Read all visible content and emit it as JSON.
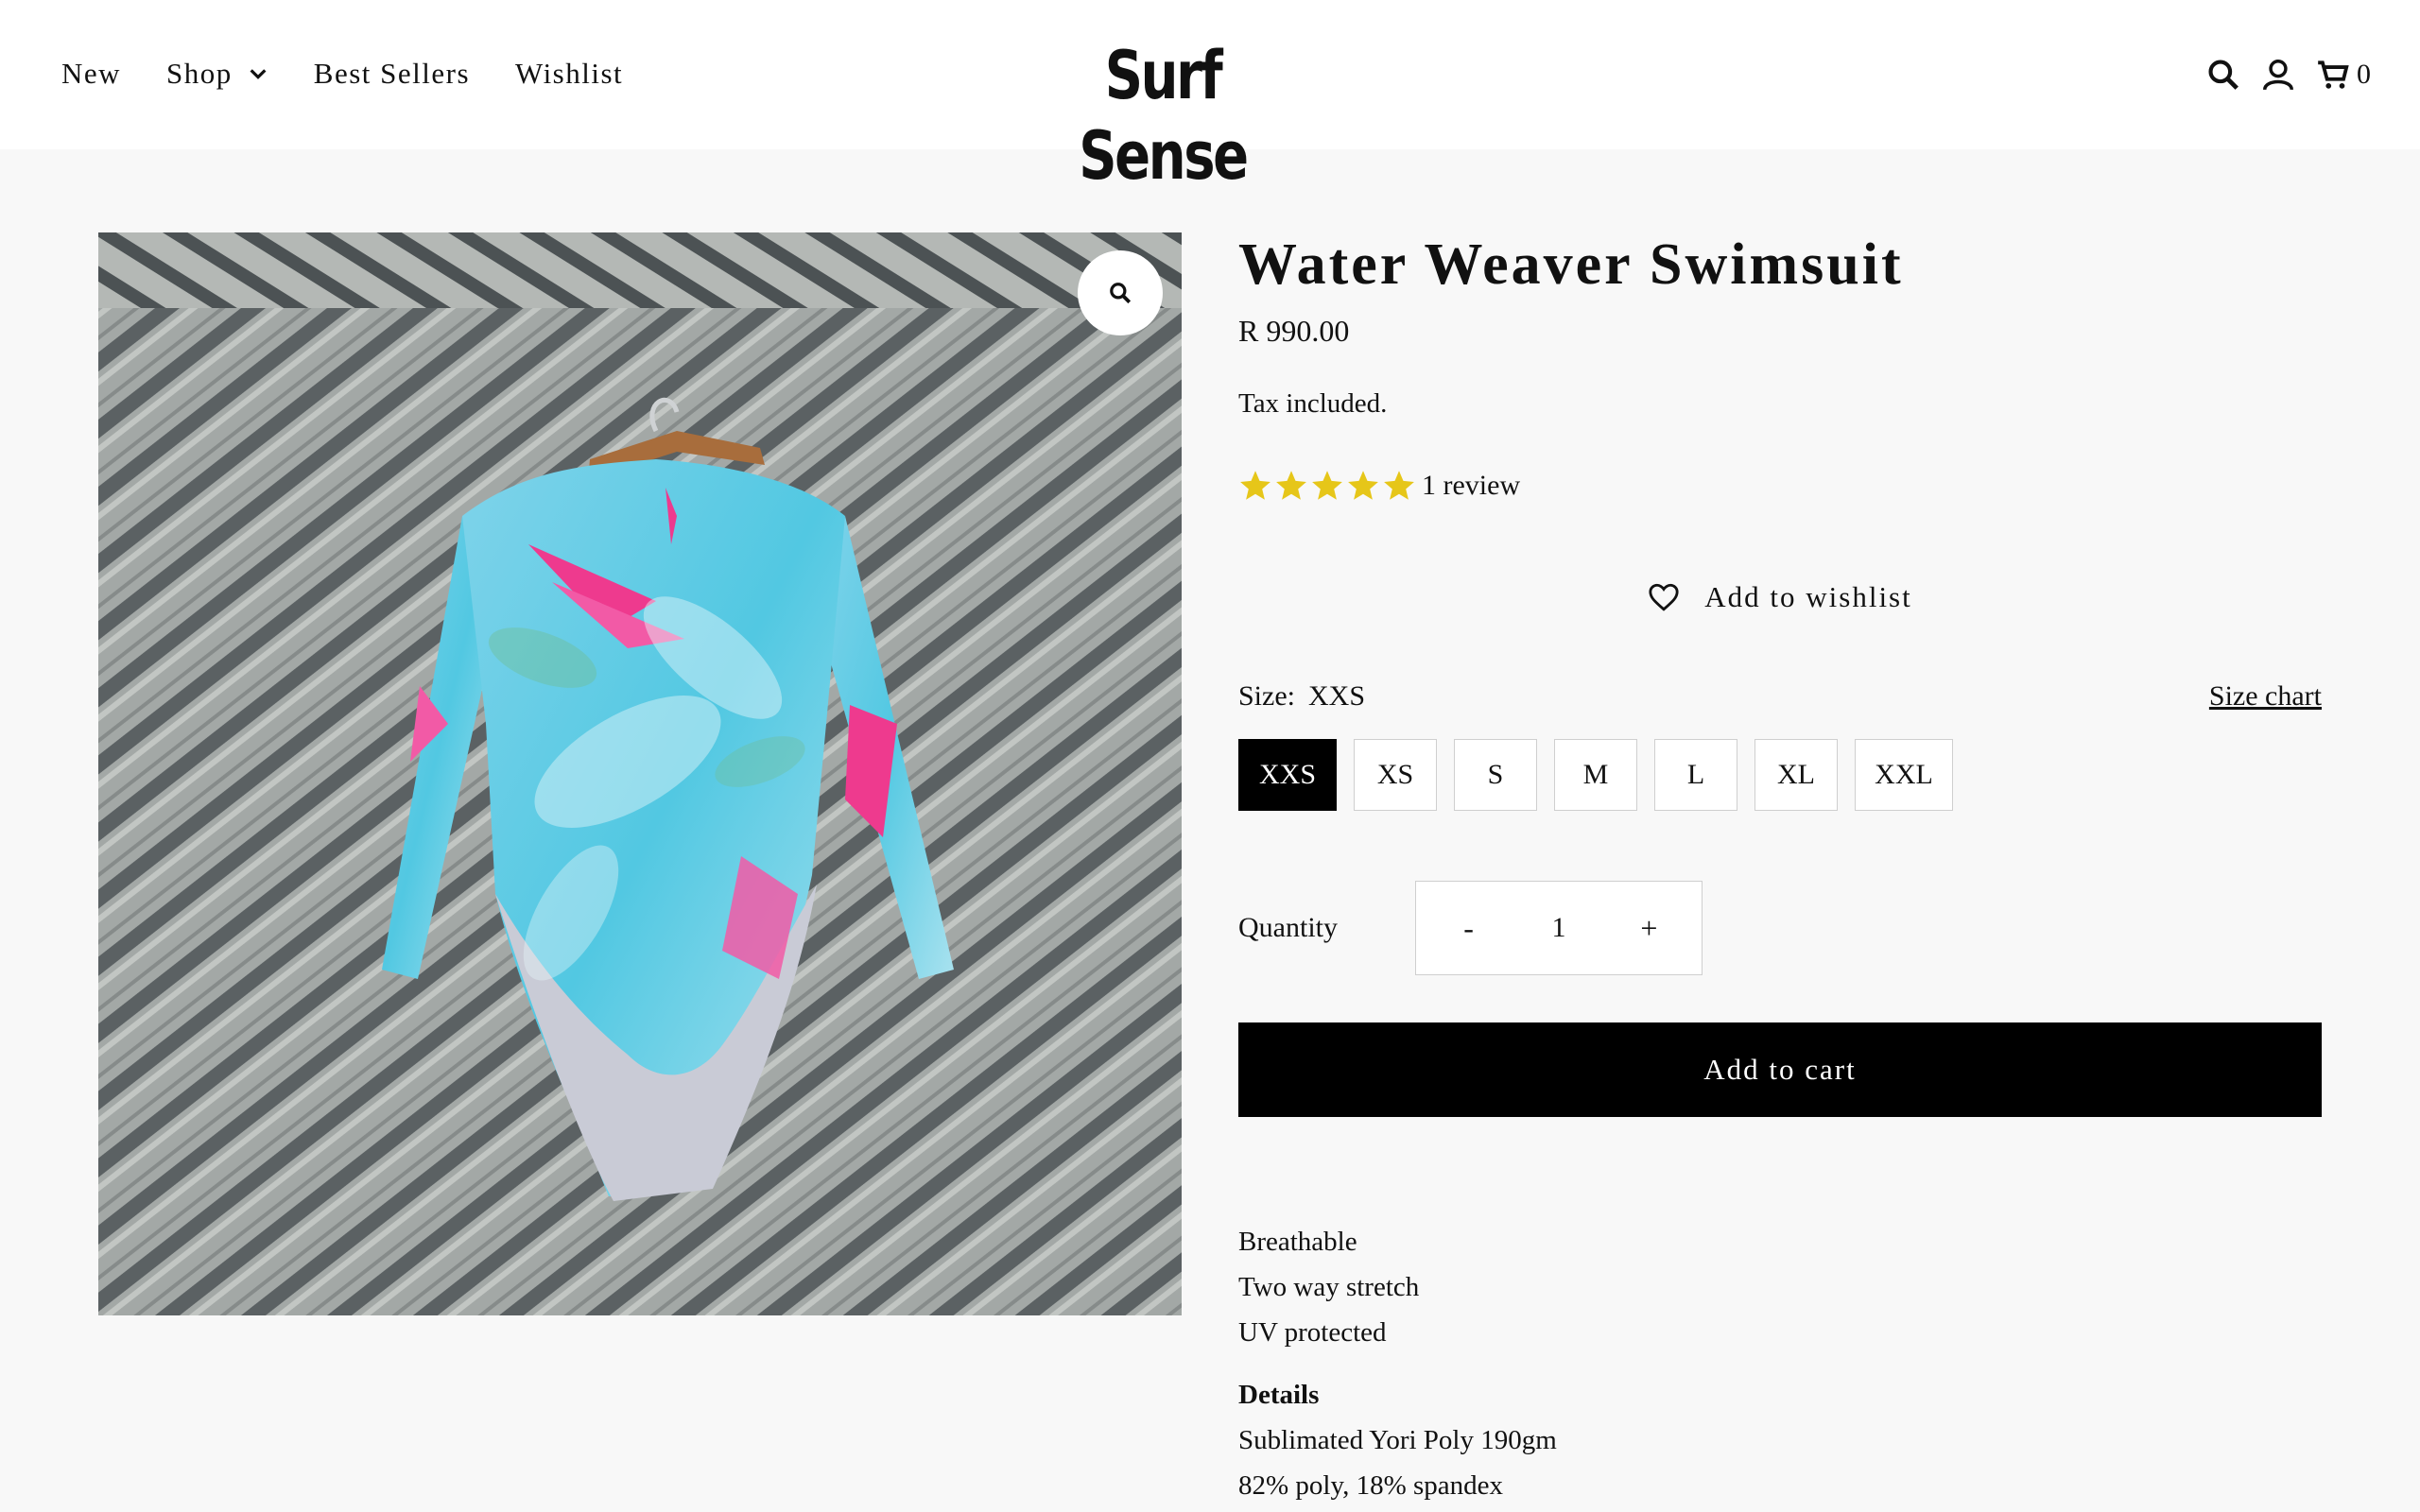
{
  "nav": {
    "items": [
      {
        "label": "New"
      },
      {
        "label": "Shop",
        "has_dropdown": true
      },
      {
        "label": "Best Sellers"
      },
      {
        "label": "Wishlist"
      }
    ]
  },
  "brand": {
    "logo_text": "Surf Sense"
  },
  "header_icons": {
    "search": "search-icon",
    "account": "account-icon",
    "cart": "cart-icon",
    "cart_count": "0"
  },
  "product": {
    "title": "Water Weaver Swimsuit",
    "price": "R 990.00",
    "tax_note": "Tax included.",
    "rating_stars": 5,
    "review_count": "1 review",
    "wishlist_label": "Add to wishlist",
    "size_label": "Size:",
    "selected_size": "XXS",
    "size_chart_label": "Size chart",
    "sizes": [
      "XXS",
      "XS",
      "S",
      "M",
      "L",
      "XL",
      "XXL"
    ],
    "quantity_label": "Quantity",
    "quantity_minus": "-",
    "quantity_value": "1",
    "quantity_plus": "+",
    "add_to_cart_label": "Add to cart",
    "features": [
      "Breathable",
      "Two way stretch",
      "UV protected"
    ],
    "details_heading": "Details",
    "details": [
      "Sublimated Yori Poly 190gm",
      "82% poly, 18% spandex"
    ]
  },
  "colors": {
    "accent": "#000000",
    "star": "#e6c619",
    "background": "#f8f8f8"
  }
}
